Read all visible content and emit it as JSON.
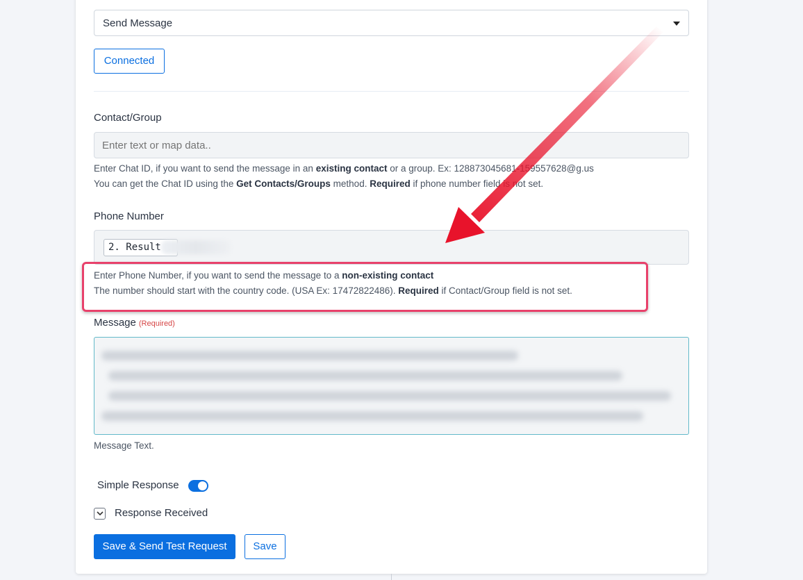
{
  "action_select": {
    "value": "Send Message"
  },
  "connection": {
    "button_label": "Connected"
  },
  "contact_group": {
    "label": "Contact/Group",
    "placeholder": "Enter text or map data..",
    "help_line1_pre": "Enter Chat ID, if you want to send the message in an ",
    "help_line1_bold": "existing contact",
    "help_line1_post": " or a group. Ex: 128873045681-159557628@g.us",
    "help_line2_pre": "You can get the Chat ID using the ",
    "help_line2_bold": "Get Contacts/Groups",
    "help_line2_mid": " method. ",
    "help_line2_bold2": "Required",
    "help_line2_post": " if phone number field is not set."
  },
  "phone_number": {
    "label": "Phone Number",
    "chip": "2. Result :",
    "help_line1_pre": "Enter Phone Number, if you want to send the message to a ",
    "help_line1_bold": "non-existing contact",
    "help_line2_pre": "The number should start with the country code. (USA Ex: 17472822486). ",
    "help_line2_bold": "Required",
    "help_line2_post": " if Contact/Group field is not set."
  },
  "message": {
    "label": "Message",
    "required_tag": "(Required)",
    "help": "Message Text."
  },
  "options": {
    "simple_response_label": "Simple Response",
    "simple_response_on": true,
    "response_received_label": "Response Received"
  },
  "actions": {
    "save_and_test_label": "Save & Send Test Request",
    "save_label": "Save"
  },
  "colors": {
    "primary": "#0b6fe0",
    "highlight": "#e8416b",
    "arrow": "#e8132b",
    "required": "#d64545"
  }
}
